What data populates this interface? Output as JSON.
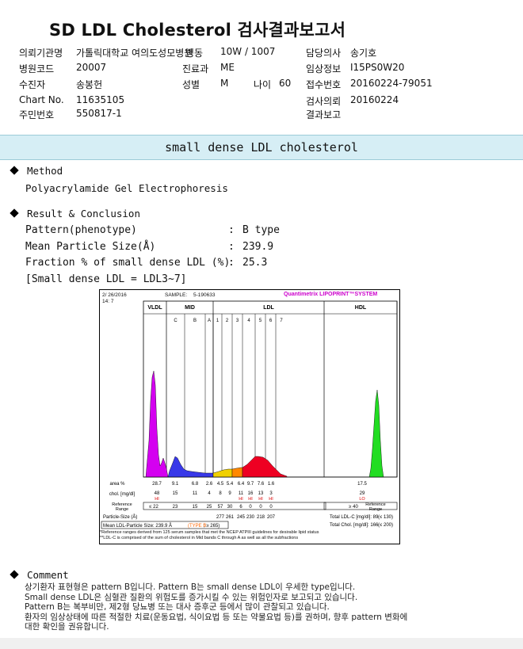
{
  "title": "SD LDL Cholesterol 검사결과보고서",
  "header": [
    {
      "label": "의뢰기관명",
      "value": "가톨릭대학교 여의도성모병원",
      "key": "org"
    },
    {
      "label": "병동",
      "value": "10W / 1007",
      "key": "ward"
    },
    {
      "label": "담당의사",
      "value": "송기호",
      "key": "doctor"
    },
    {
      "label": "병원코드",
      "value": "20007",
      "key": "hcode"
    },
    {
      "label": "진료과",
      "value": "ME",
      "key": "dept"
    },
    {
      "label": "임상정보",
      "value": "I15PS0W20",
      "key": "clinical"
    },
    {
      "label": "수진자",
      "value": "송봉헌",
      "key": "patient"
    },
    {
      "label": "성별",
      "value": "M",
      "key": "sex"
    },
    {
      "label": "나이",
      "value": "60",
      "key": "age"
    },
    {
      "label": "접수번호",
      "value": "20160224-79051",
      "key": "recno"
    },
    {
      "label": "Chart No.",
      "value": "11635105",
      "key": "chart"
    },
    {
      "label": "검사의뢰",
      "value": "20160224",
      "key": "reqdate"
    },
    {
      "label": "주민번호",
      "value": "550817-1",
      "key": "ssn"
    },
    {
      "label": "결과보고",
      "value": "",
      "key": "report"
    }
  ],
  "section_title": "small dense LDL cholesterol",
  "method": {
    "heading": "Method",
    "text": "Polyacrylamide Gel Electrophoresis"
  },
  "result": {
    "heading": "Result & Conclusion",
    "rows": [
      {
        "label": "Pattern(phenotype)",
        "sep": ":",
        "value": "B type"
      },
      {
        "label": "Mean Particle Size(Å)",
        "sep": ":",
        "value": "239.9"
      },
      {
        "label": "Fraction % of small dense LDL (%)",
        "sep": ":",
        "value": "25.3"
      }
    ],
    "note": "[Small dense LDL = LDL3~7]"
  },
  "chart_data": {
    "type": "area",
    "title": "Quantimetrix LIPOPRINT™SYSTEM",
    "date": "2/ 26/2016",
    "time": "14: 7",
    "sample": "SAMPLE:",
    "sample_id": "5-190633",
    "groups": [
      "VLDL",
      "MID",
      "LDL",
      "HDL"
    ],
    "bands": [
      "C",
      "B",
      "A",
      "1",
      "2",
      "3",
      "4",
      "5",
      "6",
      "7"
    ],
    "area_pct": [
      "28.7",
      "9.1",
      "6.8",
      "2.6",
      "4.5",
      "5.4",
      "6.4",
      "9.7",
      "7.6",
      "1.6",
      "17.5"
    ],
    "area_label": "area %",
    "chol_label": "chol. [mg/dl]",
    "chol": [
      "48",
      "15",
      "11",
      "4",
      "8",
      "9",
      "11",
      "16",
      "13",
      "3",
      "29"
    ],
    "flags": [
      "HI",
      "",
      "",
      "",
      "",
      "",
      "HI",
      "HI",
      "HI",
      "HI",
      "LO"
    ],
    "ref_label": "Reference Range",
    "ref": [
      "≤ 22",
      "23",
      "15",
      "25",
      "57",
      "30",
      "6",
      "0",
      "0",
      "0",
      "≥ 40"
    ],
    "particle_size_label": "Particle-Size (Å)",
    "particle_size": [
      "277",
      "261",
      "245",
      "230",
      "218",
      "207"
    ],
    "mean_label": "Mean LDL-Particle Size:",
    "mean_value": "239.9 Å",
    "mean_type": "(TYPE B",
    "mean_ref": "; ≥ 265)",
    "total_ldl_label": "Total LDL-C [mg/dl]:",
    "total_ldl": "89",
    "total_ldl_ref": "(≤ 130)",
    "total_chol_label": "Total Chol. [mg/dl]:",
    "total_chol": "166",
    "total_chol_ref": "(≤ 200)",
    "footnote1": "*Reference ranges derived from 125 serum samples that met the NCEP ATPIII guidelines for desirable lipid status",
    "footnote2": "**LDL-C is comprised of the sum of cholesterol in Mid bands C through A as well as all the subfractions",
    "colors": {
      "vldl": "#d400f0",
      "mid": "#3838e8",
      "ldl1": "#f0d000",
      "ldl2": "#ff8800",
      "ldl3": "#ee0022",
      "hdl": "#22dd22",
      "title": "#cc00cc",
      "type": "#ff6600",
      "flag": "#dd0000"
    }
  },
  "comment": {
    "heading": "Comment",
    "lines": [
      "상기환자 표현형은 pattern B입니다. Pattern B는 small dense LDL이 우세한 type입니다.",
      "Small dense LDL은 심혈관 질환의 위험도를 증가시킬 수 있는 위험인자로 보고되고 있습니다.",
      "Pattern B는 복부비만, 제2형 당뇨병 또는 대사 증후군 등에서 많이 관찰되고 있습니다.",
      "환자의 임상상태에 따른 적절한 치료(운동요법, 식이요법 등 또는 약물요법 등)를 권하며, 향후 pattern 변화에",
      "대한 확인을 권유합니다."
    ]
  }
}
